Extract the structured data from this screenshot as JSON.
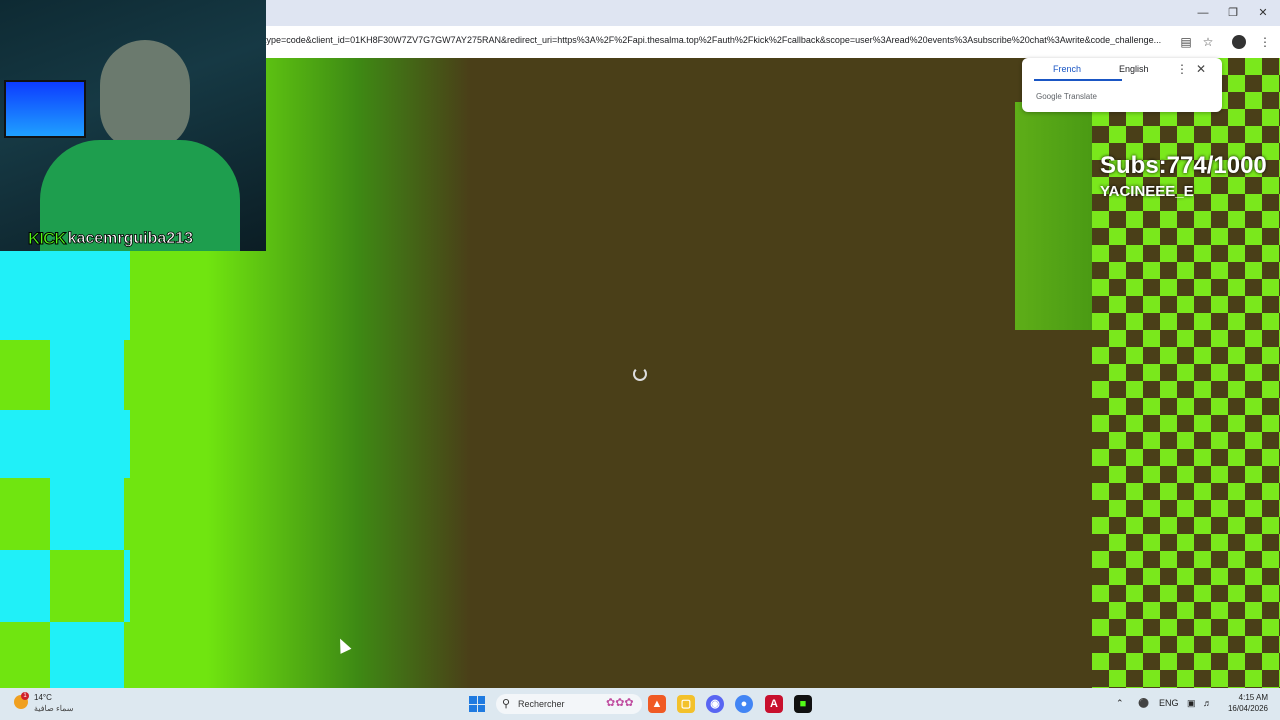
{
  "browser": {
    "url": "type=code&client_id=01KH8F30W7ZV7G7GW7AY275RAN&redirect_uri=https%3A%2F%2Fapi.thesalma.top%2Fauth%2Fkick%2Fcallback&scope=user%3Aread%20events%3Asubscribe%20chat%3Awrite&code_challenge...",
    "window_controls": [
      "minimize-icon",
      "restore-icon",
      "close-icon"
    ],
    "toolbar_icons": [
      "translate-icon",
      "star-icon",
      "profile-avatar",
      "menu-icon"
    ]
  },
  "translate_popup": {
    "tab_active": "French",
    "tab_other": "English",
    "brand": "Google Translate"
  },
  "overlay": {
    "subs": "Subs:774/1000",
    "name": "YACINEEE_E"
  },
  "webcam": {
    "platform": "KICK",
    "channel": "kacemrguiba213"
  },
  "taskbar": {
    "temperature": "14°C",
    "weather_desc": "سماء صافية",
    "weather_badge": "1",
    "search_placeholder": "Rechercher",
    "lang": "ENG",
    "time": "4:15 AM",
    "date": "16/04/2026",
    "apps": [
      "windows-start-icon",
      "brave-icon",
      "file-explorer-icon",
      "discord-icon",
      "chrome-icon",
      "app-a-icon",
      "app-green-icon"
    ]
  },
  "colors": {
    "green": "#70e510",
    "cyan": "#20f0f8",
    "background": "#4a3f18",
    "accent": "#1a56c4"
  }
}
